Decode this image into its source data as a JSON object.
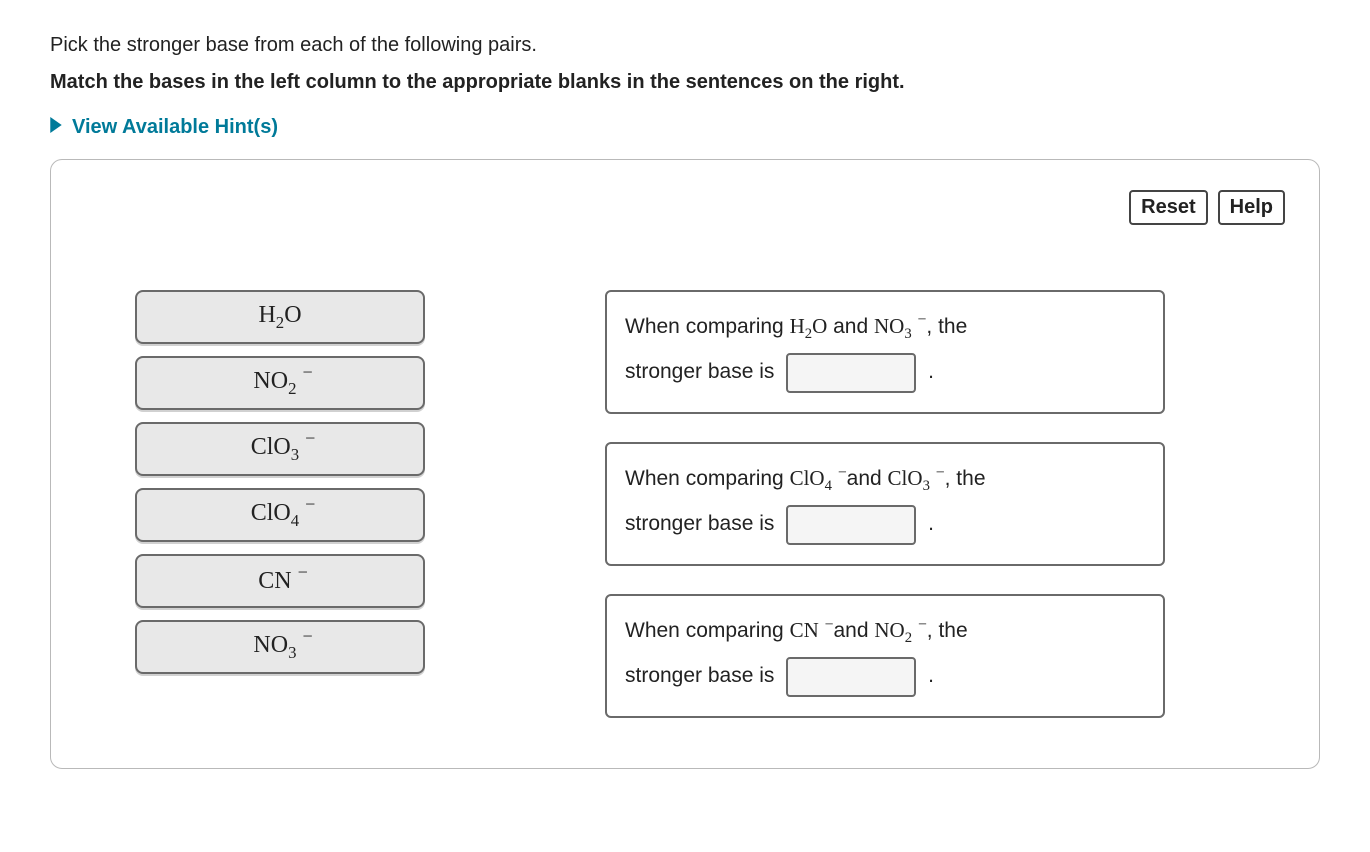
{
  "intro": {
    "line1": "Pick the stronger base from each of the following pairs.",
    "line2": "Match the bases in the left column to the appropriate blanks in the sentences on the right."
  },
  "hints_label": "View Available Hint(s)",
  "buttons": {
    "reset": "Reset",
    "help": "Help"
  },
  "tiles": [
    "H2O",
    "NO2-",
    "ClO3-",
    "ClO4-",
    "CN-",
    "NO3-"
  ],
  "sentences": [
    {
      "compare_prefix": "When comparing ",
      "a": "H2O",
      "and": " and ",
      "b": "NO3-",
      "tail": " , the",
      "line2_pre": "stronger base is ",
      "line2_post": " ."
    },
    {
      "compare_prefix": "When comparing ",
      "a": "ClO4-",
      "and": " and ",
      "b": "ClO3-",
      "tail": " , the",
      "line2_pre": "stronger base is ",
      "line2_post": " ."
    },
    {
      "compare_prefix": "When comparing ",
      "a": "CN-",
      "and": " and ",
      "b": "NO2-",
      "tail": " , the",
      "line2_pre": "stronger base is ",
      "line2_post": " ."
    }
  ]
}
